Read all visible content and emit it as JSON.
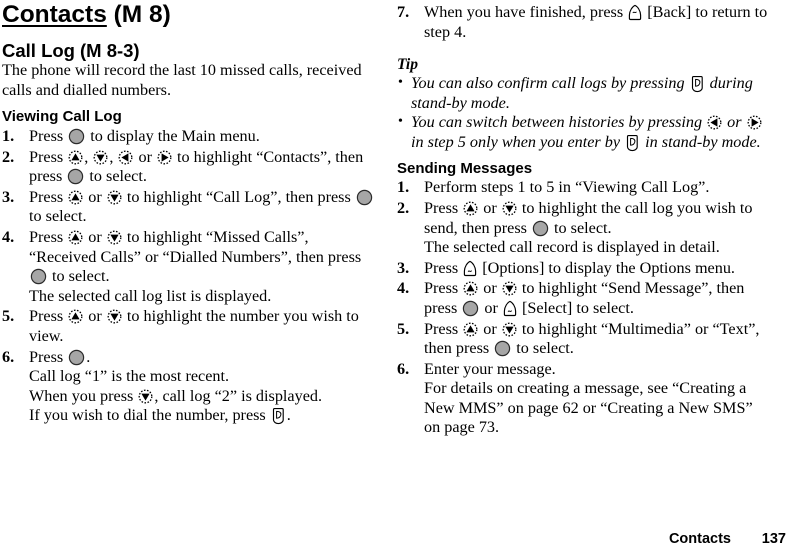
{
  "page": {
    "title": "Contacts",
    "title_suffix": "(M 8)",
    "footer_title": "Contacts",
    "footer_page": "137"
  },
  "icons": {
    "center_key": "center-select-key-icon",
    "up_key": "navigation-up-key-icon",
    "down_key": "navigation-down-key-icon",
    "left_key": "navigation-left-key-icon",
    "right_key": "navigation-right-key-icon",
    "left_soft_key": "left-soft-key-icon",
    "right_soft_key": "right-soft-key-icon",
    "send_key": "send-call-key-icon"
  },
  "left_column": {
    "section_heading": "Call Log",
    "section_heading_suffix": "(M 8-3)",
    "intro": "The phone will record the last 10 missed calls, received calls and dialled numbers.",
    "subsection_heading": "Viewing Call Log",
    "steps": [
      {
        "num": "1.",
        "parts": [
          {
            "t": "text",
            "v": "Press "
          },
          {
            "t": "icon",
            "v": "center"
          },
          {
            "t": "text",
            "v": " to display the Main menu."
          }
        ]
      },
      {
        "num": "2.",
        "parts": [
          {
            "t": "text",
            "v": "Press "
          },
          {
            "t": "icon",
            "v": "up"
          },
          {
            "t": "text",
            "v": ", "
          },
          {
            "t": "icon",
            "v": "down"
          },
          {
            "t": "text",
            "v": ", "
          },
          {
            "t": "icon",
            "v": "left"
          },
          {
            "t": "text",
            "v": " or "
          },
          {
            "t": "icon",
            "v": "right"
          },
          {
            "t": "text",
            "v": " to highlight “Contacts”, then press "
          },
          {
            "t": "icon",
            "v": "center"
          },
          {
            "t": "text",
            "v": " to select."
          }
        ]
      },
      {
        "num": "3.",
        "parts": [
          {
            "t": "text",
            "v": "Press "
          },
          {
            "t": "icon",
            "v": "up"
          },
          {
            "t": "text",
            "v": " or "
          },
          {
            "t": "icon",
            "v": "down"
          },
          {
            "t": "text",
            "v": " to highlight “Call Log”, then press "
          },
          {
            "t": "icon",
            "v": "center"
          },
          {
            "t": "text",
            "v": " to select."
          }
        ]
      },
      {
        "num": "4.",
        "parts": [
          {
            "t": "text",
            "v": "Press "
          },
          {
            "t": "icon",
            "v": "up"
          },
          {
            "t": "text",
            "v": " or "
          },
          {
            "t": "icon",
            "v": "down"
          },
          {
            "t": "text",
            "v": " to highlight “Missed Calls”, “Received Calls” or “Dialled Numbers”, then press "
          },
          {
            "t": "icon",
            "v": "center"
          },
          {
            "t": "text",
            "v": " to select."
          },
          {
            "t": "break"
          },
          {
            "t": "text",
            "v": "The selected call log list is displayed."
          }
        ]
      },
      {
        "num": "5.",
        "parts": [
          {
            "t": "text",
            "v": "Press "
          },
          {
            "t": "icon",
            "v": "up"
          },
          {
            "t": "text",
            "v": " or "
          },
          {
            "t": "icon",
            "v": "down"
          },
          {
            "t": "text",
            "v": " to highlight the number you wish to view."
          }
        ]
      },
      {
        "num": "6.",
        "parts": [
          {
            "t": "text",
            "v": "Press "
          },
          {
            "t": "icon",
            "v": "center"
          },
          {
            "t": "text",
            "v": "."
          },
          {
            "t": "break"
          },
          {
            "t": "text",
            "v": "Call log “1” is the most recent."
          },
          {
            "t": "break"
          },
          {
            "t": "text",
            "v": "When you press "
          },
          {
            "t": "icon",
            "v": "down"
          },
          {
            "t": "text",
            "v": ", call log “2” is displayed."
          },
          {
            "t": "break"
          },
          {
            "t": "text",
            "v": "If you wish to dial the number, press "
          },
          {
            "t": "icon",
            "v": "send"
          },
          {
            "t": "text",
            "v": "."
          }
        ]
      }
    ]
  },
  "right_column": {
    "steps_continued": [
      {
        "num": "7.",
        "parts": [
          {
            "t": "text",
            "v": "When you have finished, press "
          },
          {
            "t": "icon",
            "v": "rsoft"
          },
          {
            "t": "text",
            "v": " [Back] to return to step 4."
          }
        ]
      }
    ],
    "tip_heading": "Tip",
    "tips": [
      {
        "parts": [
          {
            "t": "text",
            "v": "You can also confirm call logs by pressing "
          },
          {
            "t": "icon",
            "v": "send"
          },
          {
            "t": "text",
            "v": " during stand-by mode."
          }
        ]
      },
      {
        "parts": [
          {
            "t": "text",
            "v": "You can switch between histories by pressing "
          },
          {
            "t": "icon",
            "v": "left"
          },
          {
            "t": "text",
            "v": " or "
          },
          {
            "t": "icon",
            "v": "right"
          },
          {
            "t": "text",
            "v": " in step 5 only when you enter by "
          },
          {
            "t": "icon",
            "v": "send"
          },
          {
            "t": "text",
            "v": " in stand-by mode."
          }
        ]
      }
    ],
    "subsection_heading": "Sending Messages",
    "steps": [
      {
        "num": "1.",
        "parts": [
          {
            "t": "text",
            "v": "Perform steps 1 to 5 in “Viewing Call Log”."
          }
        ]
      },
      {
        "num": "2.",
        "parts": [
          {
            "t": "text",
            "v": "Press "
          },
          {
            "t": "icon",
            "v": "up"
          },
          {
            "t": "text",
            "v": " or "
          },
          {
            "t": "icon",
            "v": "down"
          },
          {
            "t": "text",
            "v": " to highlight the call log you wish to send, then press "
          },
          {
            "t": "icon",
            "v": "center"
          },
          {
            "t": "text",
            "v": " to select."
          },
          {
            "t": "break"
          },
          {
            "t": "text",
            "v": "The selected call record is displayed in detail."
          }
        ]
      },
      {
        "num": "3.",
        "parts": [
          {
            "t": "text",
            "v": "Press "
          },
          {
            "t": "icon",
            "v": "lsoft"
          },
          {
            "t": "text",
            "v": " [Options] to display the Options menu."
          }
        ]
      },
      {
        "num": "4.",
        "parts": [
          {
            "t": "text",
            "v": "Press "
          },
          {
            "t": "icon",
            "v": "up"
          },
          {
            "t": "text",
            "v": " or "
          },
          {
            "t": "icon",
            "v": "down"
          },
          {
            "t": "text",
            "v": " to highlight “Send Message”, then press "
          },
          {
            "t": "icon",
            "v": "center"
          },
          {
            "t": "text",
            "v": " or "
          },
          {
            "t": "icon",
            "v": "lsoft"
          },
          {
            "t": "text",
            "v": " [Select] to select."
          }
        ]
      },
      {
        "num": "5.",
        "parts": [
          {
            "t": "text",
            "v": "Press "
          },
          {
            "t": "icon",
            "v": "up"
          },
          {
            "t": "text",
            "v": " or "
          },
          {
            "t": "icon",
            "v": "down"
          },
          {
            "t": "text",
            "v": " to highlight “Multimedia” or “Text”, then press "
          },
          {
            "t": "icon",
            "v": "center"
          },
          {
            "t": "text",
            "v": " to select."
          }
        ]
      },
      {
        "num": "6.",
        "parts": [
          {
            "t": "text",
            "v": "Enter your message."
          },
          {
            "t": "break"
          },
          {
            "t": "text",
            "v": "For details on creating a message, see “Creating a New MMS” on page 62 or “Creating a New SMS” on page 73."
          }
        ]
      }
    ]
  }
}
